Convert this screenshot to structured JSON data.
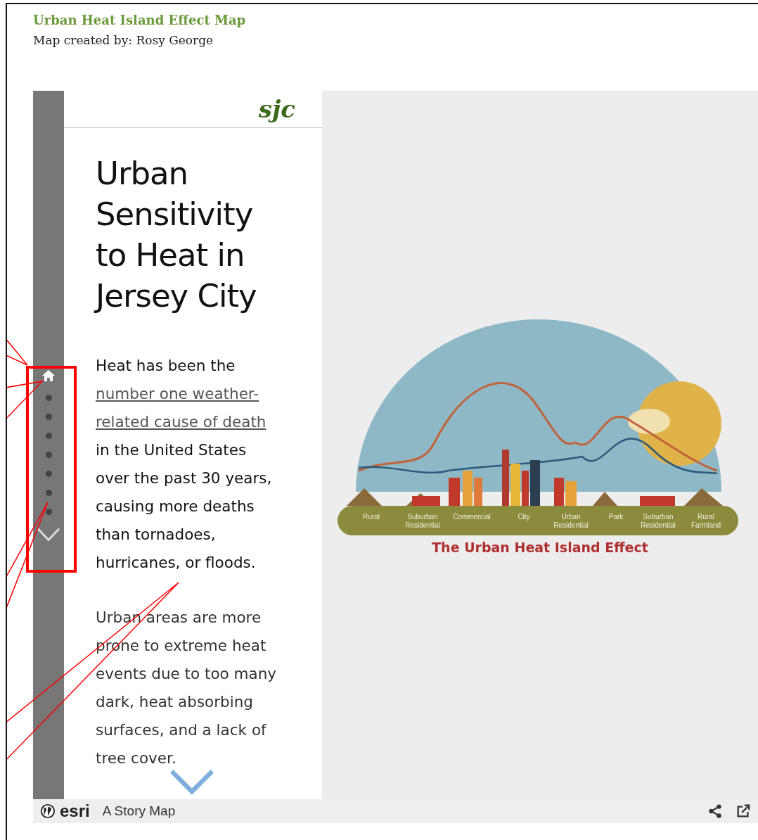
{
  "header": {
    "title": "Urban Heat Island Effect Map",
    "subtitle": "Map created by: Rosy George"
  },
  "nav": {
    "items": [
      {
        "kind": "home",
        "selected": true
      },
      {
        "kind": "dot",
        "selected": false
      },
      {
        "kind": "dot",
        "selected": false
      },
      {
        "kind": "dot",
        "selected": false
      },
      {
        "kind": "dot",
        "selected": false
      },
      {
        "kind": "dot",
        "selected": false
      },
      {
        "kind": "dot",
        "selected": false
      },
      {
        "kind": "dot",
        "selected": false
      },
      {
        "kind": "next",
        "selected": false
      }
    ]
  },
  "panel": {
    "logo": "sjc",
    "title": "Urban Sensitivity to Heat in Jersey City",
    "paragraphs": [
      {
        "before": "Heat has been the ",
        "link": "number one weather-related cause of death",
        "after": " in the United States over the past 30 years, causing more deaths than tornadoes, hurricanes, or floods."
      },
      {
        "before": "Urban areas are more prone to extreme heat events due to too many dark, heat absorbing surfaces, and a lack of tree cover."
      }
    ]
  },
  "illustration": {
    "labels": [
      "Rural",
      "Suburban Residential",
      "Commercial",
      "City",
      "Urban Residential",
      "Park",
      "Suburban Residential",
      "Rural Farmland"
    ],
    "caption": "The Urban Heat Island Effect"
  },
  "footer": {
    "brand": "esri",
    "label": "A Story Map"
  }
}
